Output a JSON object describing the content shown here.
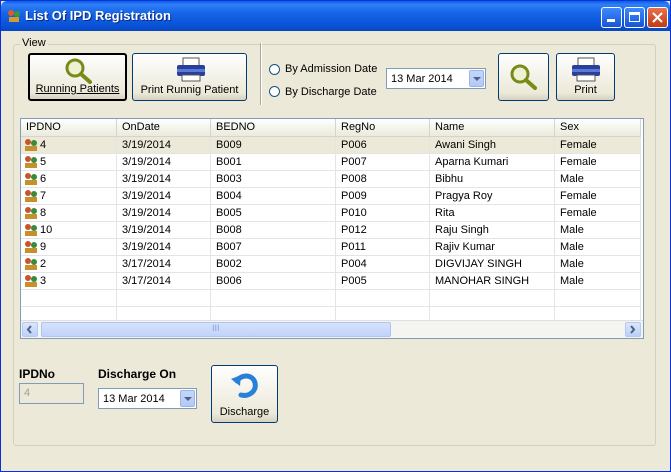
{
  "window": {
    "title": "List Of IPD Registration",
    "minimize_icon": "minimize-icon",
    "maximize_icon": "maximize-icon",
    "close_icon": "close-icon",
    "accent": "#0a53d9"
  },
  "view": {
    "group_label": "View",
    "running_patients_label": "Running Patients",
    "print_running_label": "Print Runnig Patient",
    "by_admission_label": "By Admission Date",
    "by_discharge_label": "By Discharge Date",
    "filter_date": "13 Mar 2014",
    "print_label": "Print"
  },
  "grid": {
    "columns": [
      "IPDNO",
      "OnDate",
      "BEDNO",
      "RegNo",
      "Name",
      "Sex"
    ],
    "rows": [
      {
        "ipdno": "4",
        "ondate": "3/19/2014",
        "bedno": "B009",
        "regno": "P006",
        "name": "Awani Singh",
        "sex": "Female"
      },
      {
        "ipdno": "5",
        "ondate": "3/19/2014",
        "bedno": "B001",
        "regno": "P007",
        "name": "Aparna Kumari",
        "sex": "Female"
      },
      {
        "ipdno": "6",
        "ondate": "3/19/2014",
        "bedno": "B003",
        "regno": "P008",
        "name": "Bibhu",
        "sex": "Male"
      },
      {
        "ipdno": "7",
        "ondate": "3/19/2014",
        "bedno": "B004",
        "regno": "P009",
        "name": "Pragya Roy",
        "sex": "Female"
      },
      {
        "ipdno": "8",
        "ondate": "3/19/2014",
        "bedno": "B005",
        "regno": "P010",
        "name": "Rita",
        "sex": "Female"
      },
      {
        "ipdno": "10",
        "ondate": "3/19/2014",
        "bedno": "B008",
        "regno": "P012",
        "name": "Raju Singh",
        "sex": "Male"
      },
      {
        "ipdno": "9",
        "ondate": "3/19/2014",
        "bedno": "B007",
        "regno": "P011",
        "name": "Rajiv Kumar",
        "sex": "Male"
      },
      {
        "ipdno": "2",
        "ondate": "3/17/2014",
        "bedno": "B002",
        "regno": "P004",
        "name": "DIGVIJAY SINGH",
        "sex": "Male"
      },
      {
        "ipdno": "3",
        "ondate": "3/17/2014",
        "bedno": "B006",
        "regno": "P005",
        "name": "MANOHAR SINGH",
        "sex": "Male"
      }
    ],
    "scroll_grip": "III"
  },
  "footer": {
    "ipdno_label": "IPDNo",
    "ipdno_value": "4",
    "discharge_on_label": "Discharge On",
    "discharge_date": "13 Mar 2014",
    "discharge_button_label": "Discharge"
  }
}
